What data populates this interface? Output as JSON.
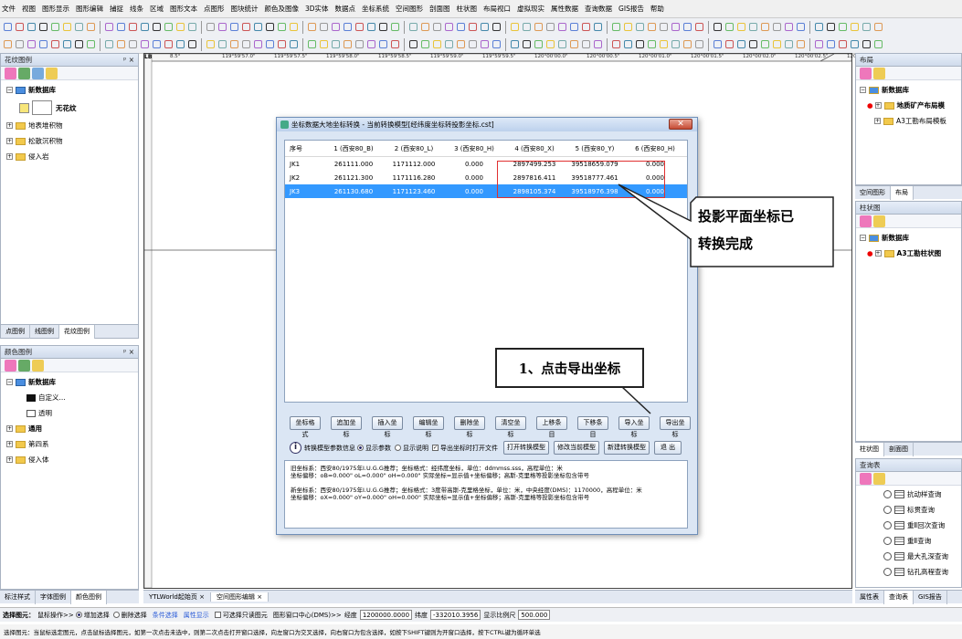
{
  "menu": [
    "文件",
    "视图",
    "图形显示",
    "图形编辑",
    "捕捉",
    "线条",
    "区域",
    "图形文本",
    "点图形",
    "图块统计",
    "颜色及图像",
    "3D实体",
    "数据点",
    "坐标系统",
    "空间图形",
    "剖面图",
    "柱状图",
    "布局视口",
    "虚拟现实",
    "属性数据",
    "查询数据",
    "GIS报告",
    "帮助"
  ],
  "left_top_panel": {
    "title": "花纹图例",
    "root": "新数据库",
    "items": [
      "无花纹",
      "地表堆积物",
      "松散沉积物",
      "侵入岩"
    ],
    "tabs": [
      "点图例",
      "线图例",
      "花纹图例"
    ]
  },
  "left_bottom_panel": {
    "title": "颜色图例",
    "root": "新数据库",
    "items": [
      "自定义...",
      "透明",
      "通用",
      "第四系",
      "侵入体"
    ]
  },
  "left_bottom_tabs": [
    "标注样式",
    "字体图例",
    "颜色图例"
  ],
  "map": {
    "coord_labels": [
      "8.5°",
      "119°59'57.0\"",
      "119°59'57.5\"",
      "119°59'58.0\"",
      "119°59'58.5\"",
      "119°59'59.0\"",
      "119°59'59.5\"",
      "120°00'00.0\"",
      "120°00'00.5\"",
      "120°00'01.0\"",
      "120°00'01.5\"",
      "120°00'02.0\"",
      "120°00'02.5\"",
      "120°00'03.0\""
    ],
    "label_lb": "LB",
    "doc_tabs": [
      "YTLWorld起始页",
      "空间图形编辑"
    ]
  },
  "dialog": {
    "title": "坐标数据大地坐标转换 - 当前转换模型[经纬度坐标转投影坐标.cst]",
    "columns": [
      "序号",
      "1 (西安80_B)",
      "2 (西安80_L)",
      "3 (西安80_H)",
      "4 (西安80_X)",
      "5 (西安80_Y)",
      "6 (西安80_H)"
    ],
    "rows": [
      [
        "JK1",
        "261111.000",
        "1171112.000",
        "0.000",
        "2897499.253",
        "39518659.079",
        "0.000"
      ],
      [
        "JK2",
        "261121.300",
        "1171116.280",
        "0.000",
        "2897816.411",
        "39518777.461",
        "0.000"
      ],
      [
        "JK3",
        "261130.680",
        "1171123.460",
        "0.000",
        "2898105.374",
        "39518976.398",
        "0.000"
      ]
    ],
    "selected_row": 2,
    "buttons": [
      "坐标格式",
      "追加坐标",
      "插入坐标",
      "编辑坐标",
      "删除坐标",
      "清空坐标",
      "上移条目",
      "下移条目",
      "导入坐标",
      "导出坐标"
    ],
    "options": {
      "label": "转换模型参数信息",
      "radio1": "显示参数",
      "radio2": "显示说明",
      "check": "导出坐标时打开文件",
      "btn1": "打开转换模型",
      "btn2": "修改当前模型",
      "btn3": "新建转换模型",
      "btn4": "退 出"
    },
    "info": [
      "旧坐标系：西安80/1975年I.U.G.G推荐；坐标格式：经纬度坐标，单位：ddmmss.sss，高程单位：米",
      "坐标偏移：oB=0.000\"  oL=0.000\"  oH=0.000\"  实际坐标=显示值+坐标偏移；高斯-克里格等投影坐标包含带号",
      "新坐标系：西安80/1975年I.U.G.G推荐；坐标格式：3度带高斯-克里格坐标，单位：米，中央经度(DMS)：1170000，高程单位：米",
      "坐标偏移：oX=0.000\"  oY=0.000\"  oH=0.000\"  实际坐标=显示值+坐标偏移；高斯-克里格等投影坐标包含带号"
    ]
  },
  "callout_text": [
    "投影平面坐标已",
    "转换完成"
  ],
  "annotation": "1、点击导出坐标",
  "right_panels": {
    "layout": {
      "title": "布局",
      "root": "新数据库",
      "items": [
        "地质矿产布局模",
        "A3工勘布局模板"
      ]
    },
    "layout_tabs": [
      "空间图形",
      "布局"
    ],
    "column": {
      "title": "柱状图",
      "root": "新数据库",
      "items": [
        "A3工勘柱状图"
      ]
    },
    "column_tabs": [
      "柱状图",
      "剖面图"
    ],
    "query": {
      "title": "查询表",
      "items": [
        "抗动样查询",
        "标贯查询",
        "重Ⅱ回次查询",
        "重Ⅱ查询",
        "最大孔深查询",
        "钻孔高程查询"
      ]
    },
    "bottom_tabs": [
      "属性表",
      "查询表",
      "GIS报告"
    ]
  },
  "status": {
    "label": "选择图元：",
    "mouse": "鼠标操作>>",
    "opt1": "增加选择",
    "opt2": "删除选择",
    "opt3": "条件选择",
    "opt4": "属性显示",
    "opt5": "可选择只读图元",
    "center": "图形窗口中心(DMS)>>",
    "lon_label": "经度",
    "lon": "1200000.0000",
    "lat_label": "纬度",
    "lat": "-332010.3956",
    "scale_label": "显示比例尺",
    "scale": "500.000"
  },
  "hint": "选择图元：当鼠标选定图元，点击鼠标选择图元，如第一次点击未选中，则第二次点击打开窗口选择，向左窗口为交叉选择，向右窗口为包含选择，如按下SHIFT键则为开窗口选择，按下CTRL键为循环单选"
}
